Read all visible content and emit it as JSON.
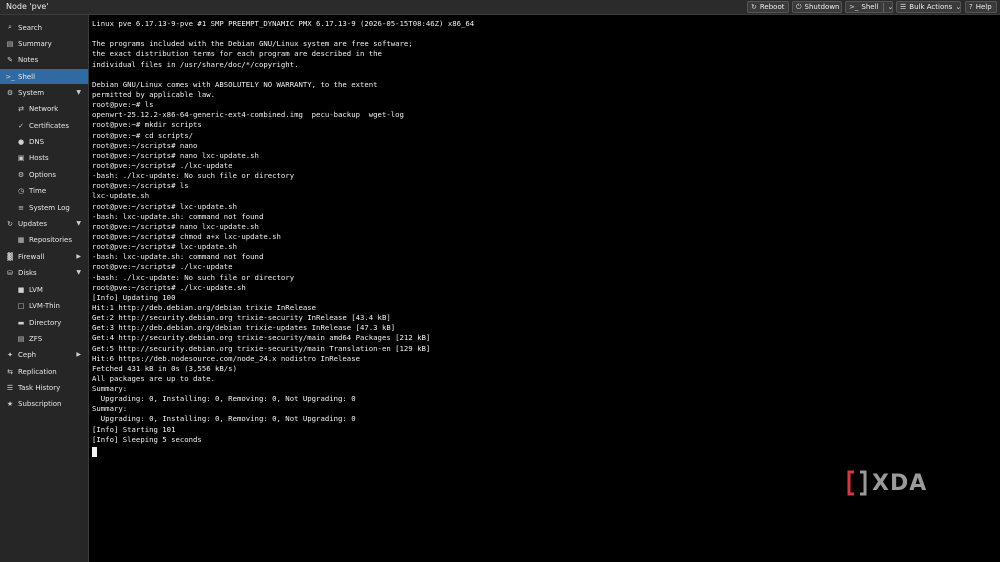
{
  "header": {
    "node_title": "Node 'pve'",
    "buttons": [
      {
        "label": "Reboot",
        "icon": "reboot-icon"
      },
      {
        "label": "Shutdown",
        "icon": "power-icon"
      },
      {
        "label": "Shell",
        "icon": "terminal-icon"
      },
      {
        "label": "Bulk Actions",
        "icon": "bulk-actions-icon"
      },
      {
        "label": "Help",
        "icon": "help-icon"
      }
    ]
  },
  "sidebar": {
    "items": [
      {
        "label": "Search",
        "icon": "search-icon",
        "level": 0
      },
      {
        "label": "Summary",
        "icon": "summary-icon",
        "level": 0
      },
      {
        "label": "Notes",
        "icon": "notes-icon",
        "level": 0
      },
      {
        "label": "Shell",
        "icon": "shell-icon",
        "level": 0,
        "selected": true
      },
      {
        "label": "System",
        "icon": "system-icon",
        "level": 0,
        "expandable": true
      },
      {
        "label": "Network",
        "icon": "network-icon",
        "level": 1
      },
      {
        "label": "Certificates",
        "icon": "certificate-icon",
        "level": 1
      },
      {
        "label": "DNS",
        "icon": "dns-icon",
        "level": 1
      },
      {
        "label": "Hosts",
        "icon": "hosts-icon",
        "level": 1
      },
      {
        "label": "Options",
        "icon": "options-icon",
        "level": 1
      },
      {
        "label": "Time",
        "icon": "clock-icon",
        "level": 1
      },
      {
        "label": "System Log",
        "icon": "log-icon",
        "level": 1
      },
      {
        "label": "Updates",
        "icon": "updates-icon",
        "level": 0,
        "expandable": true
      },
      {
        "label": "Repositories",
        "icon": "repositories-icon",
        "level": 1
      },
      {
        "label": "Firewall",
        "icon": "firewall-icon",
        "level": 0,
        "expandable": true
      },
      {
        "label": "Disks",
        "icon": "disks-icon",
        "level": 0,
        "expandable": true
      },
      {
        "label": "LVM",
        "icon": "lvm-icon",
        "level": 1
      },
      {
        "label": "LVM-Thin",
        "icon": "lvm-thin-icon",
        "level": 1
      },
      {
        "label": "Directory",
        "icon": "directory-icon",
        "level": 1
      },
      {
        "label": "ZFS",
        "icon": "zfs-icon",
        "level": 1
      },
      {
        "label": "Ceph",
        "icon": "ceph-icon",
        "level": 0,
        "expandable": true
      },
      {
        "label": "Replication",
        "icon": "replication-icon",
        "level": 0
      },
      {
        "label": "Task History",
        "icon": "task-history-icon",
        "level": 0
      },
      {
        "label": "Subscription",
        "icon": "subscription-icon",
        "level": 0
      }
    ]
  },
  "terminal": {
    "lines": [
      "Linux pve 6.17.13-9-pve #1 SMP PREEMPT_DYNAMIC PMX 6.17.13-9 (2026-05-15T08:46Z) x86_64",
      "",
      "The programs included with the Debian GNU/Linux system are free software;",
      "the exact distribution terms for each program are described in the",
      "individual files in /usr/share/doc/*/copyright.",
      "",
      "Debian GNU/Linux comes with ABSOLUTELY NO WARRANTY, to the extent",
      "permitted by applicable law.",
      "root@pve:~# ls",
      "openwrt-25.12.2-x86-64-generic-ext4-combined.img  pecu-backup  wget-log",
      "root@pve:~# mkdir scripts",
      "root@pve:~# cd scripts/",
      "root@pve:~/scripts# nano",
      "root@pve:~/scripts# nano lxc-update.sh",
      "root@pve:~/scripts# ./lxc-update",
      "-bash: ./lxc-update: No such file or directory",
      "root@pve:~/scripts# ls",
      "lxc-update.sh",
      "root@pve:~/scripts# lxc-update.sh",
      "-bash: lxc-update.sh: command not found",
      "root@pve:~/scripts# nano lxc-update.sh",
      "root@pve:~/scripts# chmod a+x lxc-update.sh",
      "root@pve:~/scripts# lxc-update.sh",
      "-bash: lxc-update.sh: command not found",
      "root@pve:~/scripts# ./lxc-update",
      "-bash: ./lxc-update: No such file or directory",
      "root@pve:~/scripts# ./lxc-update.sh",
      "[Info] Updating 100",
      "Hit:1 http://deb.debian.org/debian trixie InRelease",
      "Get:2 http://security.debian.org trixie-security InRelease [43.4 kB]",
      "Get:3 http://deb.debian.org/debian trixie-updates InRelease [47.3 kB]",
      "Get:4 http://security.debian.org trixie-security/main amd64 Packages [212 kB]",
      "Get:5 http://security.debian.org trixie-security/main Translation-en [129 kB]",
      "Hit:6 https://deb.nodesource.com/node_24.x nodistro InRelease",
      "Fetched 431 kB in 0s (3,556 kB/s)",
      "All packages are up to date.",
      "Summary:",
      "  Upgrading: 0, Installing: 0, Removing: 0, Not Upgrading: 0",
      "Summary:",
      "  Upgrading: 0, Installing: 0, Removing: 0, Not Upgrading: 0",
      "[Info] Starting 101",
      "[Info] Sleeping 5 seconds"
    ]
  },
  "watermark": {
    "text": "XDA",
    "accent": "#d9363e"
  }
}
